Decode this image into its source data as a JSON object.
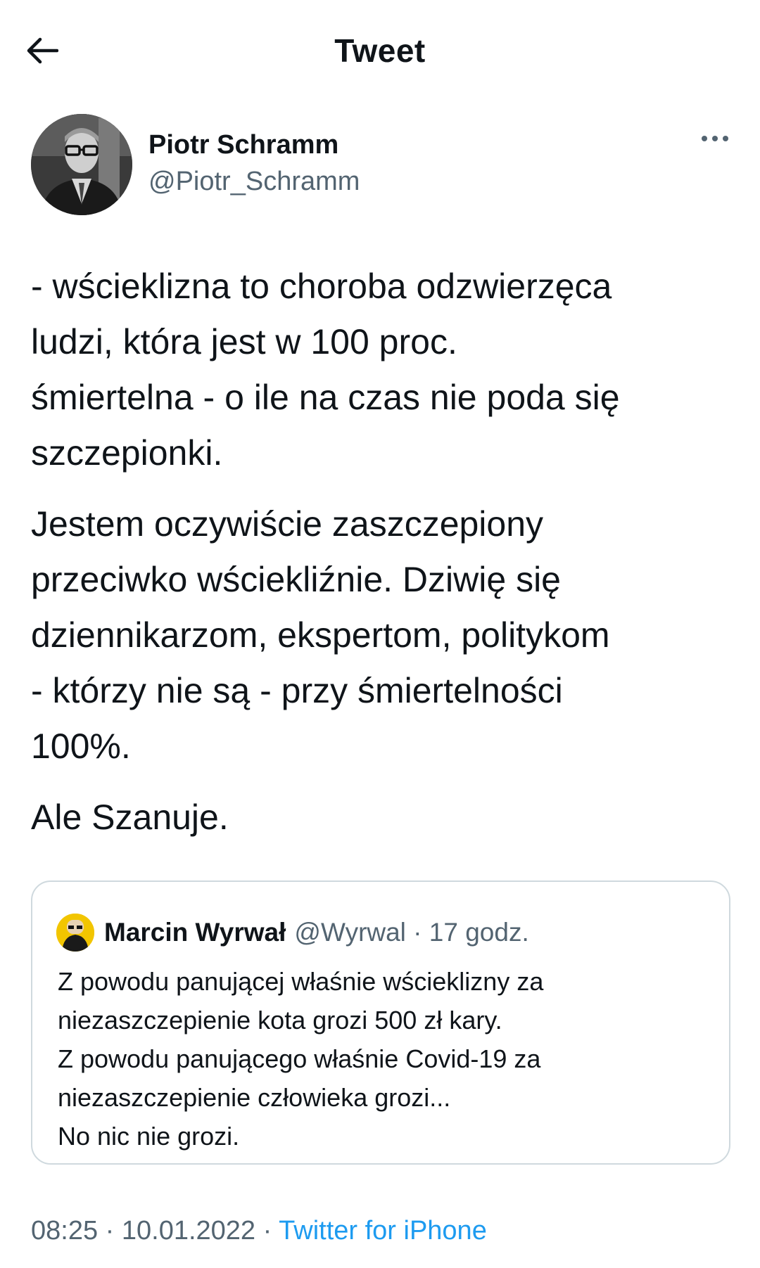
{
  "header": {
    "title": "Tweet",
    "back_icon": "arrow-left-icon"
  },
  "author": {
    "name": "Piotr Schramm",
    "handle": "@Piotr_Schramm",
    "avatar_icon": "profile-photo",
    "more_icon": "more-dots-icon"
  },
  "tweet": {
    "paragraphs": [
      "- wścieklizna to choroba odzwierzęca\nludzi, która jest w 100 proc.\nśmiertelna - o ile na czas nie poda się\nszczepionki.",
      "Jestem oczywiście zaszczepiony\nprzeciwko wściekliźnie. Dziwię się\ndziennikarzom, ekspertom, politykom\n- którzy nie są - przy śmiertelności\n100%.",
      "Ale Szanuje."
    ]
  },
  "quote": {
    "name": "Marcin Wyrwał",
    "meta": "@Wyrwal · 17 godz.",
    "avatar_icon": "cartoon-avatar",
    "text": "Z powodu panującej właśnie wścieklizny za\nniezaszczepienie kota grozi 500 zł kary.\nZ powodu panującego właśnie Covid-19 za\nniezaszczepienie człowieka grozi...\nNo nic nie grozi."
  },
  "footer": {
    "timestamp": "08:25 · 10.01.2022 · ",
    "source": "Twitter for iPhone"
  },
  "colors": {
    "text": "#0f1419",
    "secondary": "#536471",
    "link": "#1d9bf0",
    "border": "#cfd9de"
  }
}
